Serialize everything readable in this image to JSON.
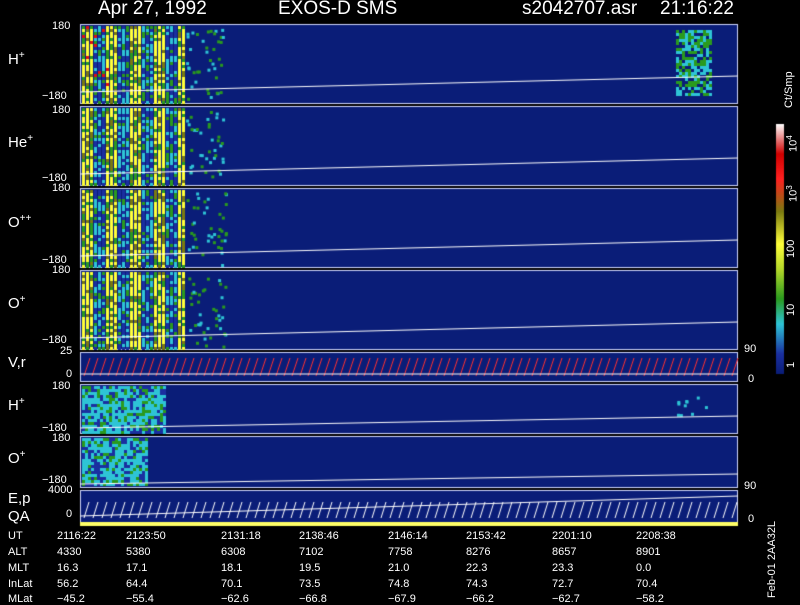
{
  "header": {
    "date": "Apr 27, 1992",
    "instrument": "EXOS-D SMS",
    "file": "s2042707.asr",
    "time": "21:16:22"
  },
  "colors": {
    "background": "#000000",
    "panel_fill": "#0a1d78",
    "trace": "#ffffff",
    "flux_low": "#1a2fa0",
    "flux_mid": "#2ec4d6",
    "flux_green": "#2a9a1e",
    "flux_yellow": "#ffff3a",
    "flux_olive": "#7a7a10",
    "flux_red": "#e01010",
    "vr_arrows": "#ff3030",
    "qa_bar": "#ffff66"
  },
  "panels": {
    "h_plus": {
      "label": "H",
      "sup": "+",
      "y_top": "180",
      "y_bottom": "−180"
    },
    "he_plus": {
      "label": "He",
      "sup": "+",
      "y_top": "180",
      "y_bottom": "−180"
    },
    "o_plusplus": {
      "label": "O",
      "sup": "++",
      "y_top": "180",
      "y_bottom": "−180"
    },
    "o_plus": {
      "label": "O",
      "sup": "+",
      "y_top": "180",
      "y_bottom": "−180"
    },
    "vr": {
      "label": "V,r",
      "y_top": "25",
      "y_zero": "0",
      "right_top": "90",
      "right_bottom": "0"
    },
    "h_plus2": {
      "label": "H",
      "sup": "+",
      "y_top": "180",
      "y_bottom": "−180"
    },
    "o_plus2": {
      "label": "O",
      "sup": "+",
      "y_top": "180",
      "y_bottom": "−180",
      "right_top": "90"
    },
    "ep": {
      "label": "E,p",
      "label2": "QA",
      "y_top": "4000",
      "y_zero": "0",
      "right_bottom": "0"
    }
  },
  "colorbar": {
    "title": "Ct/Smp",
    "ticks": [
      {
        "text": "10",
        "sup": "4"
      },
      {
        "text": "10",
        "sup": "3"
      },
      {
        "text": "100",
        "sup": ""
      },
      {
        "text": "10",
        "sup": ""
      },
      {
        "text": "1",
        "sup": ""
      }
    ]
  },
  "ephemeris": {
    "rows": [
      {
        "label": "UT",
        "values": [
          "2116:22",
          "2123:50",
          "2131:18",
          "2138:46",
          "2146:14",
          "2153:42",
          "2201:10",
          "2208:38"
        ]
      },
      {
        "label": "ALT",
        "values": [
          "4330",
          "5380",
          "6308",
          "7102",
          "7758",
          "8276",
          "8657",
          "8901"
        ]
      },
      {
        "label": "MLT",
        "values": [
          "16.3",
          "17.1",
          "18.1",
          "19.5",
          "21.0",
          "22.3",
          "23.3",
          "0.0"
        ]
      },
      {
        "label": "InLat",
        "values": [
          "56.2",
          "64.4",
          "70.1",
          "73.5",
          "74.8",
          "74.3",
          "72.7",
          "70.4"
        ]
      },
      {
        "label": "MLat",
        "values": [
          "−45.2",
          "−55.4",
          "−62.6",
          "−66.8",
          "−67.9",
          "−66.2",
          "−62.7",
          "−58.2"
        ]
      }
    ]
  },
  "footer_note": "Feb-01 2AA32L"
}
